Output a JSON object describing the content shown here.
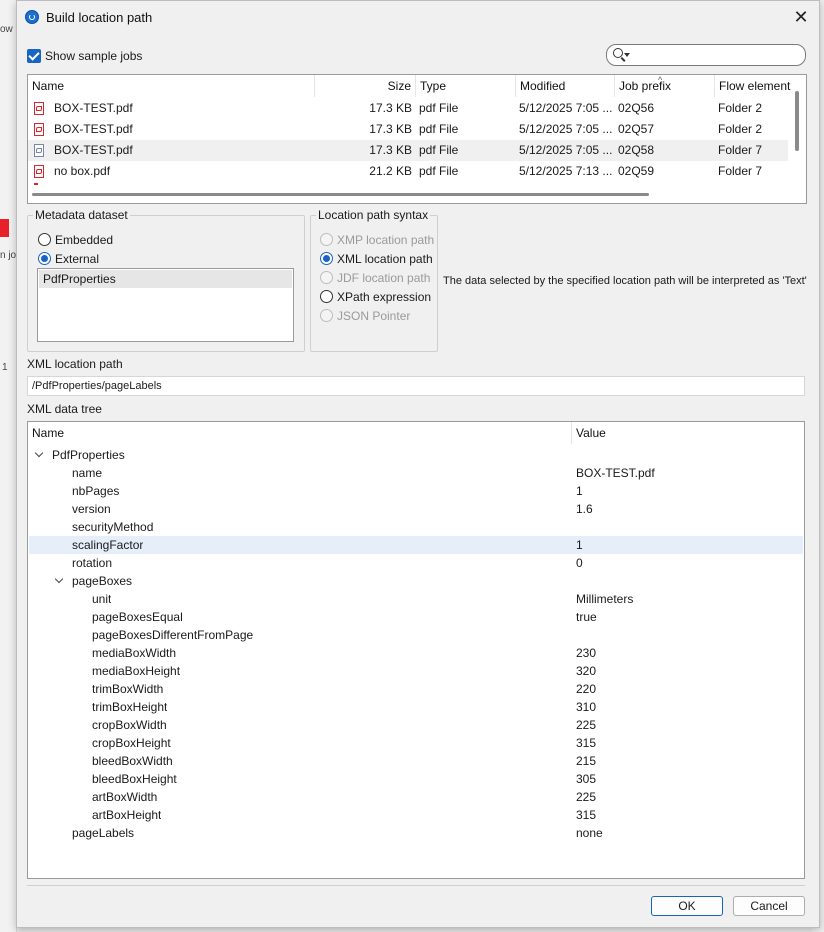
{
  "window": {
    "title": "Build location path"
  },
  "toolbar": {
    "show_sample_jobs": "Show sample jobs",
    "show_sample_jobs_checked": true
  },
  "jobs_table": {
    "headers": [
      "Name",
      "Size",
      "Type",
      "Modified",
      "Job prefix",
      "Flow element"
    ],
    "rows": [
      {
        "name": "BOX-TEST.pdf",
        "size": "17.3 KB",
        "type": "pdf File",
        "modified": "5/12/2025 7:05 ...",
        "prefix": "02Q56",
        "flow": "Folder 2"
      },
      {
        "name": "BOX-TEST.pdf",
        "size": "17.3 KB",
        "type": "pdf File",
        "modified": "5/12/2025 7:05 ...",
        "prefix": "02Q57",
        "flow": "Folder 2"
      },
      {
        "name": "BOX-TEST.pdf",
        "size": "17.3 KB",
        "type": "pdf File",
        "modified": "5/12/2025 7:05 ...",
        "prefix": "02Q58",
        "flow": "Folder 7"
      },
      {
        "name": "no box.pdf",
        "size": "21.2 KB",
        "type": "pdf File",
        "modified": "5/12/2025 7:13 ...",
        "prefix": "02Q59",
        "flow": "Folder 7"
      }
    ]
  },
  "metadata": {
    "title": "Metadata dataset",
    "embedded": "Embedded",
    "external": "External",
    "selected": "external",
    "list": [
      "PdfProperties"
    ]
  },
  "syntax": {
    "title": "Location path syntax",
    "options": [
      {
        "label": "XMP location path",
        "state": "disabled"
      },
      {
        "label": "XML location path",
        "state": "selected"
      },
      {
        "label": "JDF location path",
        "state": "disabled"
      },
      {
        "label": "XPath expression",
        "state": "enabled"
      },
      {
        "label": "JSON Pointer",
        "state": "disabled"
      }
    ]
  },
  "interpretation_note": "The data selected by the specified location path will be interpreted as 'Text'",
  "xml_path": {
    "label": "XML location path",
    "value": "/PdfProperties/pageLabels"
  },
  "tree": {
    "label": "XML data tree",
    "headers": [
      "Name",
      "Value"
    ],
    "rows": [
      {
        "name": "PdfProperties",
        "value": "",
        "level": 0,
        "expanded": true
      },
      {
        "name": "name",
        "value": "BOX-TEST.pdf",
        "level": 1
      },
      {
        "name": "nbPages",
        "value": "1",
        "level": 1
      },
      {
        "name": "version",
        "value": "1.6",
        "level": 1
      },
      {
        "name": "securityMethod",
        "value": "",
        "level": 1
      },
      {
        "name": "scalingFactor",
        "value": "1",
        "level": 1,
        "highlighted": true
      },
      {
        "name": "rotation",
        "value": "0",
        "level": 1
      },
      {
        "name": "pageBoxes",
        "value": "",
        "level": 1,
        "expanded": true
      },
      {
        "name": "unit",
        "value": "Millimeters",
        "level": 2
      },
      {
        "name": "pageBoxesEqual",
        "value": "true",
        "level": 2
      },
      {
        "name": "pageBoxesDifferentFromPage",
        "value": "",
        "level": 2
      },
      {
        "name": "mediaBoxWidth",
        "value": "230",
        "level": 2
      },
      {
        "name": "mediaBoxHeight",
        "value": "320",
        "level": 2
      },
      {
        "name": "trimBoxWidth",
        "value": "220",
        "level": 2
      },
      {
        "name": "trimBoxHeight",
        "value": "310",
        "level": 2
      },
      {
        "name": "cropBoxWidth",
        "value": "225",
        "level": 2
      },
      {
        "name": "cropBoxHeight",
        "value": "315",
        "level": 2
      },
      {
        "name": "bleedBoxWidth",
        "value": "215",
        "level": 2
      },
      {
        "name": "bleedBoxHeight",
        "value": "305",
        "level": 2
      },
      {
        "name": "artBoxWidth",
        "value": "225",
        "level": 2
      },
      {
        "name": "artBoxHeight",
        "value": "315",
        "level": 2
      },
      {
        "name": "pageLabels",
        "value": "none",
        "level": 1
      }
    ]
  },
  "buttons": {
    "ok": "OK",
    "cancel": "Cancel"
  },
  "background": {
    "left_fragment_1": "ow",
    "left_fragment_2": "n jol",
    "left_fragment_3": "1"
  },
  "colors": {
    "accent": "#1764c4",
    "pdf_icon": "#d8272d",
    "highlight_row": "#e5eef9"
  }
}
